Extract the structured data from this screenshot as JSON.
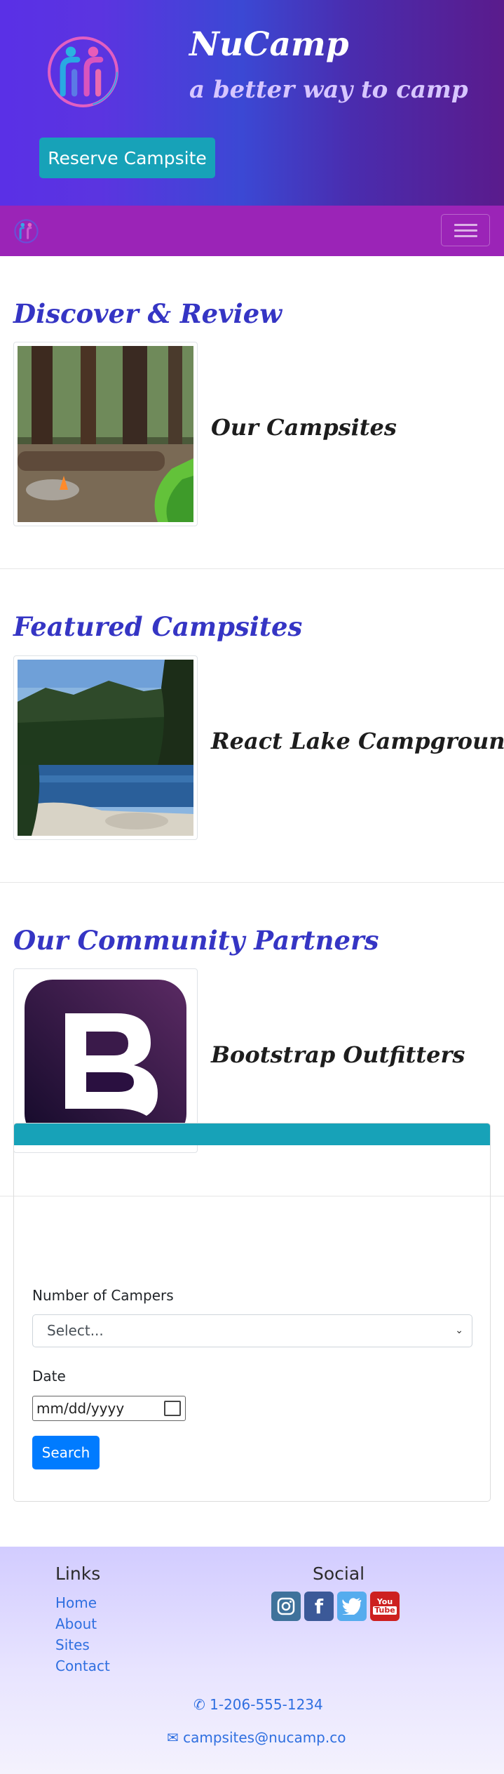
{
  "header": {
    "title": "NuCamp",
    "subtitle": "a better way to camp",
    "reserve_label": "Reserve Campsite"
  },
  "navbar": {
    "toggler_icon": "hamburger-icon"
  },
  "sections": {
    "discover": {
      "heading": "Discover & Review",
      "item_title": "Our Campsites"
    },
    "featured": {
      "heading": "Featured Campsites",
      "item_title": "React Lake Campground"
    },
    "partners": {
      "heading": "Our Community Partners",
      "item_title": "Bootstrap Outfitters"
    }
  },
  "form": {
    "campers_label": "Number of Campers",
    "campers_selected": "Select...",
    "date_label": "Date",
    "date_placeholder": "mm/dd/yyyy",
    "search_label": "Search"
  },
  "footer": {
    "links_heading": "Links",
    "links": [
      "Home",
      "About",
      "Sites",
      "Contact"
    ],
    "social_heading": "Social",
    "social_icons": [
      "instagram-icon",
      "facebook-icon",
      "twitter-icon",
      "youtube-icon"
    ],
    "phone": "1-206-555-1234",
    "email": "campsites@nucamp.co"
  },
  "colors": {
    "accent": "#17a2b8",
    "navbar": "#9b24b7",
    "heading": "#3535c4",
    "primary": "#007bff"
  }
}
